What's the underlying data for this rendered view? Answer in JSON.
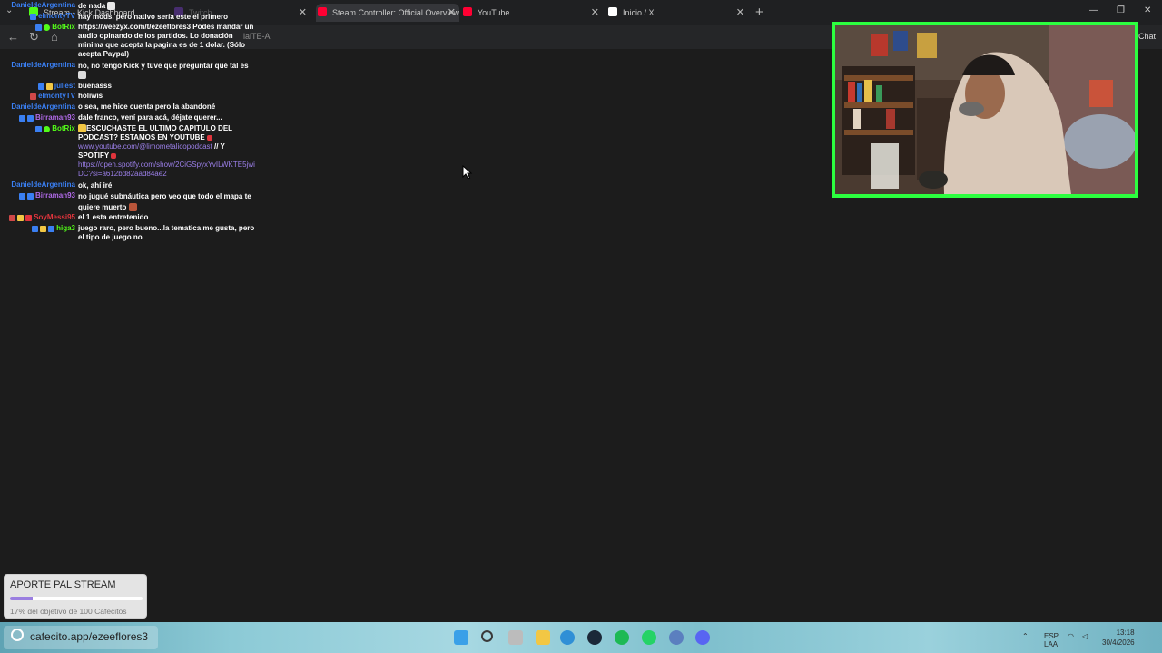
{
  "browser": {
    "tabs": [
      {
        "title": "Stream - Kick Dashboard",
        "favicon_color": "#53fc18"
      },
      {
        "title": "Twitch",
        "favicon_color": "#9146ff"
      },
      {
        "title": "Steam Controller: Official Overview",
        "favicon_color": "#ff0033"
      },
      {
        "title": "YouTube",
        "favicon_color": "#ff0033"
      },
      {
        "title": "Inicio / X",
        "favicon_color": "#ffffff"
      }
    ],
    "close_glyph": "✕",
    "new_tab_glyph": "+",
    "url_fragment": "laiTE-A",
    "chat_button_label": "Chat"
  },
  "chat": {
    "messages": [
      {
        "user": "DanieldeArgentina",
        "user_color": "#3a7ff2",
        "badges": [],
        "text": "de nada"
      },
      {
        "user": "elmontyTV",
        "user_color": "#3a7ff2",
        "badges": [
          "#3a7ff2"
        ],
        "text": "hay mods, pero nativo sería este el primero"
      },
      {
        "user": "BotRix",
        "user_color": "#53fc18",
        "badges": [
          "#3a7ff2",
          "#53fc18"
        ],
        "text": "https://weezyx.com/t/ezeeflores3 Podes mandar un audio opinando de los partidos. Lo donación minima que acepta la pagina es de 1 dolar. (Sólo acepta Paypal)"
      },
      {
        "user": "DanieldeArgentina",
        "user_color": "#3a7ff2",
        "badges": [],
        "text": "no, no tengo Kick y túve que preguntar qué tal es"
      },
      {
        "user": "juliest",
        "user_color": "#3a7ff2",
        "badges": [
          "#3a7ff2",
          "#f2c744"
        ],
        "text": "buenasss"
      },
      {
        "user": "elmontyTV",
        "user_color": "#3a7ff2",
        "badges": [
          "#d04848"
        ],
        "text": "holiwis"
      },
      {
        "user": "DanieldeArgentina",
        "user_color": "#3a7ff2",
        "badges": [],
        "text": "o sea, me hice cuenta pero la abandoné"
      },
      {
        "user": "Birraman93",
        "user_color": "#b06ae8",
        "badges": [
          "#3a7ff2",
          "#3a7ff2"
        ],
        "text": "dale franco, vení para acá, déjate querer..."
      },
      {
        "user": "BotRix",
        "user_color": "#53fc18",
        "badges": [
          "#3a7ff2",
          "#53fc18"
        ],
        "text_parts": [
          "ESCUCHASTE EL ULTIMO CAPITULO DEL PODCAST? ESTAMOS EN YOUTUBE",
          "www.youtube.com/@limometalicopodcast",
          "// Y SPOTIFY",
          "https://open.spotify.com/show/2CiGSpyxYvILWKTE5jwiDC?si=a612bd82aad84ae2"
        ]
      },
      {
        "user": "DanieldeArgentina",
        "user_color": "#3a7ff2",
        "badges": [],
        "text": "ok, ahí iré"
      },
      {
        "user": "Birraman93",
        "user_color": "#b06ae8",
        "badges": [
          "#3a7ff2",
          "#3a7ff2"
        ],
        "text": "no jugué subnáutica pero veo que todo el mapa te quiere muerto"
      },
      {
        "user": "SoyMessi95",
        "user_color": "#e0343c",
        "badges": [
          "#d04848",
          "#f2c744",
          "#e0343c"
        ],
        "text": "el 1 esta entretenido"
      },
      {
        "user": "higa3",
        "user_color": "#53fc18",
        "badges": [
          "#3a7ff2",
          "#f2c744",
          "#3a7ff2"
        ],
        "text": "juego raro, pero bueno...la tematica me gusta, pero el tipo de juego no"
      }
    ]
  },
  "donation": {
    "title": "APORTE PAL STREAM",
    "progress_percent": 17,
    "subtitle": "17% del objetivo de 100 Cafecitos"
  },
  "taskbar": {
    "search_text": "cafecito.app/ezeeflores3",
    "apps": [
      "file-explorer",
      "search",
      "task-view",
      "folder",
      "edge",
      "steam",
      "spotify",
      "whatsapp",
      "vpn",
      "discord"
    ],
    "tray_lang": "ESP\nLAA",
    "clock_time": "13:18",
    "clock_date": "30/4/2026"
  },
  "colors": {
    "webcam_border": "#2cff3f",
    "donation_fill": "#9a7ee0"
  }
}
